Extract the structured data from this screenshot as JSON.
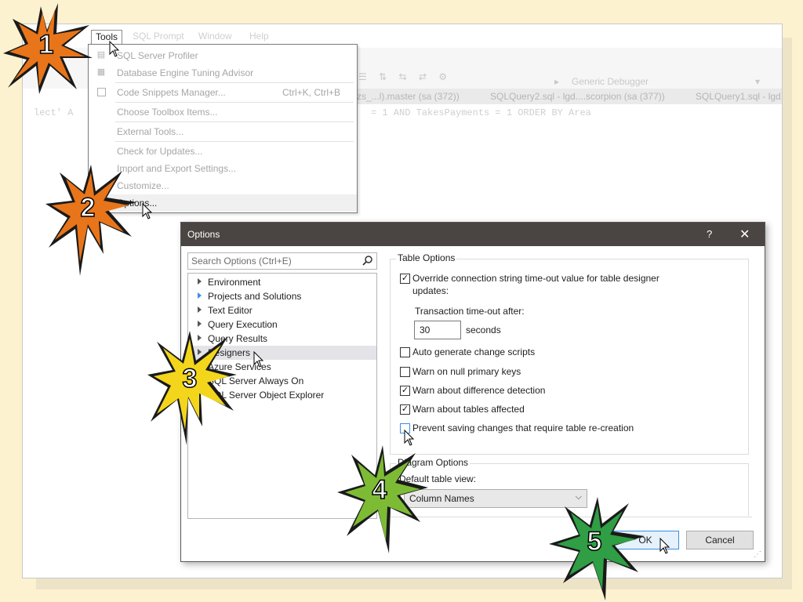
{
  "menubar": {
    "tools": "Tools",
    "sql_prompt": "SQL Prompt",
    "window": "Window",
    "help": "Help"
  },
  "toolbar": {
    "debugger": "Generic Debugger"
  },
  "tabs": [
    "zs_...l).master (sa (372))",
    "SQLQuery2.sql - lgd....scorpion (sa (377))",
    "SQLQuery1.sql - lgd..."
  ],
  "editor": {
    "code_fragment_left": "lect' A",
    "code_fragment_right": "= 1 AND TakesPayments = 1 ORDER BY Area"
  },
  "tools_menu": {
    "items": [
      {
        "label": "SQL Server Profiler",
        "icon": "profiler-icon"
      },
      {
        "label": "Database Engine Tuning Advisor",
        "icon": "tuning-advisor-icon"
      },
      {
        "label": "Code Snippets Manager...",
        "shortcut": "Ctrl+K, Ctrl+B",
        "icon": "checkbox-icon"
      },
      {
        "label": "Choose Toolbox Items..."
      },
      {
        "label": "External Tools..."
      },
      {
        "label": "Check for Updates..."
      },
      {
        "label": "Import and Export Settings..."
      },
      {
        "label": "Customize..."
      },
      {
        "label": "Options..."
      }
    ]
  },
  "options_dialog": {
    "title": "Options",
    "help": "?",
    "close": "✕",
    "search_placeholder": "Search Options (Ctrl+E)",
    "tree": [
      {
        "label": "Environment"
      },
      {
        "label": "Projects and Solutions"
      },
      {
        "label": "Text Editor"
      },
      {
        "label": "Query Execution"
      },
      {
        "label": "Query Results"
      },
      {
        "label": "Designers"
      },
      {
        "label": "Azure Services"
      },
      {
        "label": "SQL Server Always On"
      },
      {
        "label": "SQL Server Object Explorer"
      }
    ],
    "table_options": {
      "group_label": "Table Options",
      "override_line1": "Override connection string time-out value for table designer",
      "override_line2": "updates:",
      "override_checked": true,
      "timeout_label": "Transaction time-out after:",
      "timeout_value": "30",
      "timeout_unit": "seconds",
      "auto_generate": "Auto generate change scripts",
      "auto_generate_checked": false,
      "warn_null_pk": "Warn on null primary keys",
      "warn_null_pk_checked": false,
      "warn_diff": "Warn about difference detection",
      "warn_diff_checked": true,
      "warn_tables": "Warn about tables affected",
      "warn_tables_checked": true,
      "prevent_saving": "Prevent saving changes that require table re-creation",
      "prevent_saving_checked": false
    },
    "diagram_options": {
      "group_label": "Diagram Options",
      "default_view_label": "Default table view:",
      "default_view_value": "Column Names"
    },
    "ok": "OK",
    "cancel": "Cancel"
  },
  "callouts": [
    {
      "number": "1",
      "color": "#e8751a"
    },
    {
      "number": "2",
      "color": "#e8751a"
    },
    {
      "number": "3",
      "color": "#f3d61c"
    },
    {
      "number": "4",
      "color": "#7dbb35"
    },
    {
      "number": "5",
      "color": "#2f9e44"
    }
  ]
}
